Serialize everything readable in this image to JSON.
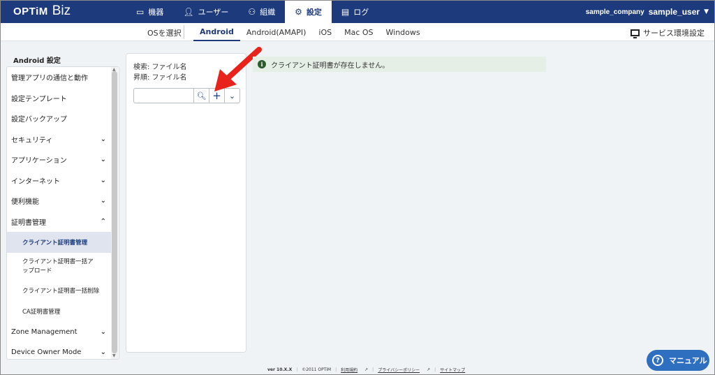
{
  "header": {
    "logo_main": "OPTiM",
    "logo_sub": "Biz",
    "nav": [
      {
        "label": "機器",
        "icon": "device-icon"
      },
      {
        "label": "ユーザー",
        "icon": "user-icon"
      },
      {
        "label": "組織",
        "icon": "organization-icon"
      },
      {
        "label": "設定",
        "icon": "gear-icon"
      },
      {
        "label": "ログ",
        "icon": "log-icon"
      }
    ],
    "company": "sample_company",
    "user": "sample_user"
  },
  "osbar": {
    "label": "OSを選択",
    "tabs": [
      "Android",
      "Android(AMAPI)",
      "iOS",
      "Mac OS",
      "Windows"
    ],
    "service_settings": "サービス環境設定"
  },
  "sidebar": {
    "heading": "Android 設定",
    "items": [
      {
        "label": "管理アプリの通信と動作"
      },
      {
        "label": "設定テンプレート"
      },
      {
        "label": "設定バックアップ"
      },
      {
        "label": "セキュリティ"
      },
      {
        "label": "アプリケーション"
      },
      {
        "label": "インターネット"
      },
      {
        "label": "便利機能"
      },
      {
        "label": "証明書管理"
      },
      {
        "label": "クライアント証明書管理"
      },
      {
        "label": "クライアント証明書一括アップロード"
      },
      {
        "label": "クライアント証明書一括削除"
      },
      {
        "label": "CA証明書管理"
      },
      {
        "label": "Zone Management"
      },
      {
        "label": "Device Owner Mode"
      }
    ]
  },
  "panel": {
    "search_label": "検索: ファイル名",
    "sort_label": "昇順: ファイル名",
    "search_value": ""
  },
  "notice": {
    "text": "クライアント証明書が存在しません。"
  },
  "footer": {
    "version": "ver 10.X.X",
    "copyright": "©2011 OPTiM",
    "terms": "利用規約",
    "privacy": "プライバシーポリシー",
    "sitemap": "サイトマップ"
  },
  "manual": {
    "label": "マニュアル"
  },
  "colors": {
    "header_bg": "#1d3a7c",
    "accent": "#2f6fc0",
    "arrow": "#e8231b"
  }
}
